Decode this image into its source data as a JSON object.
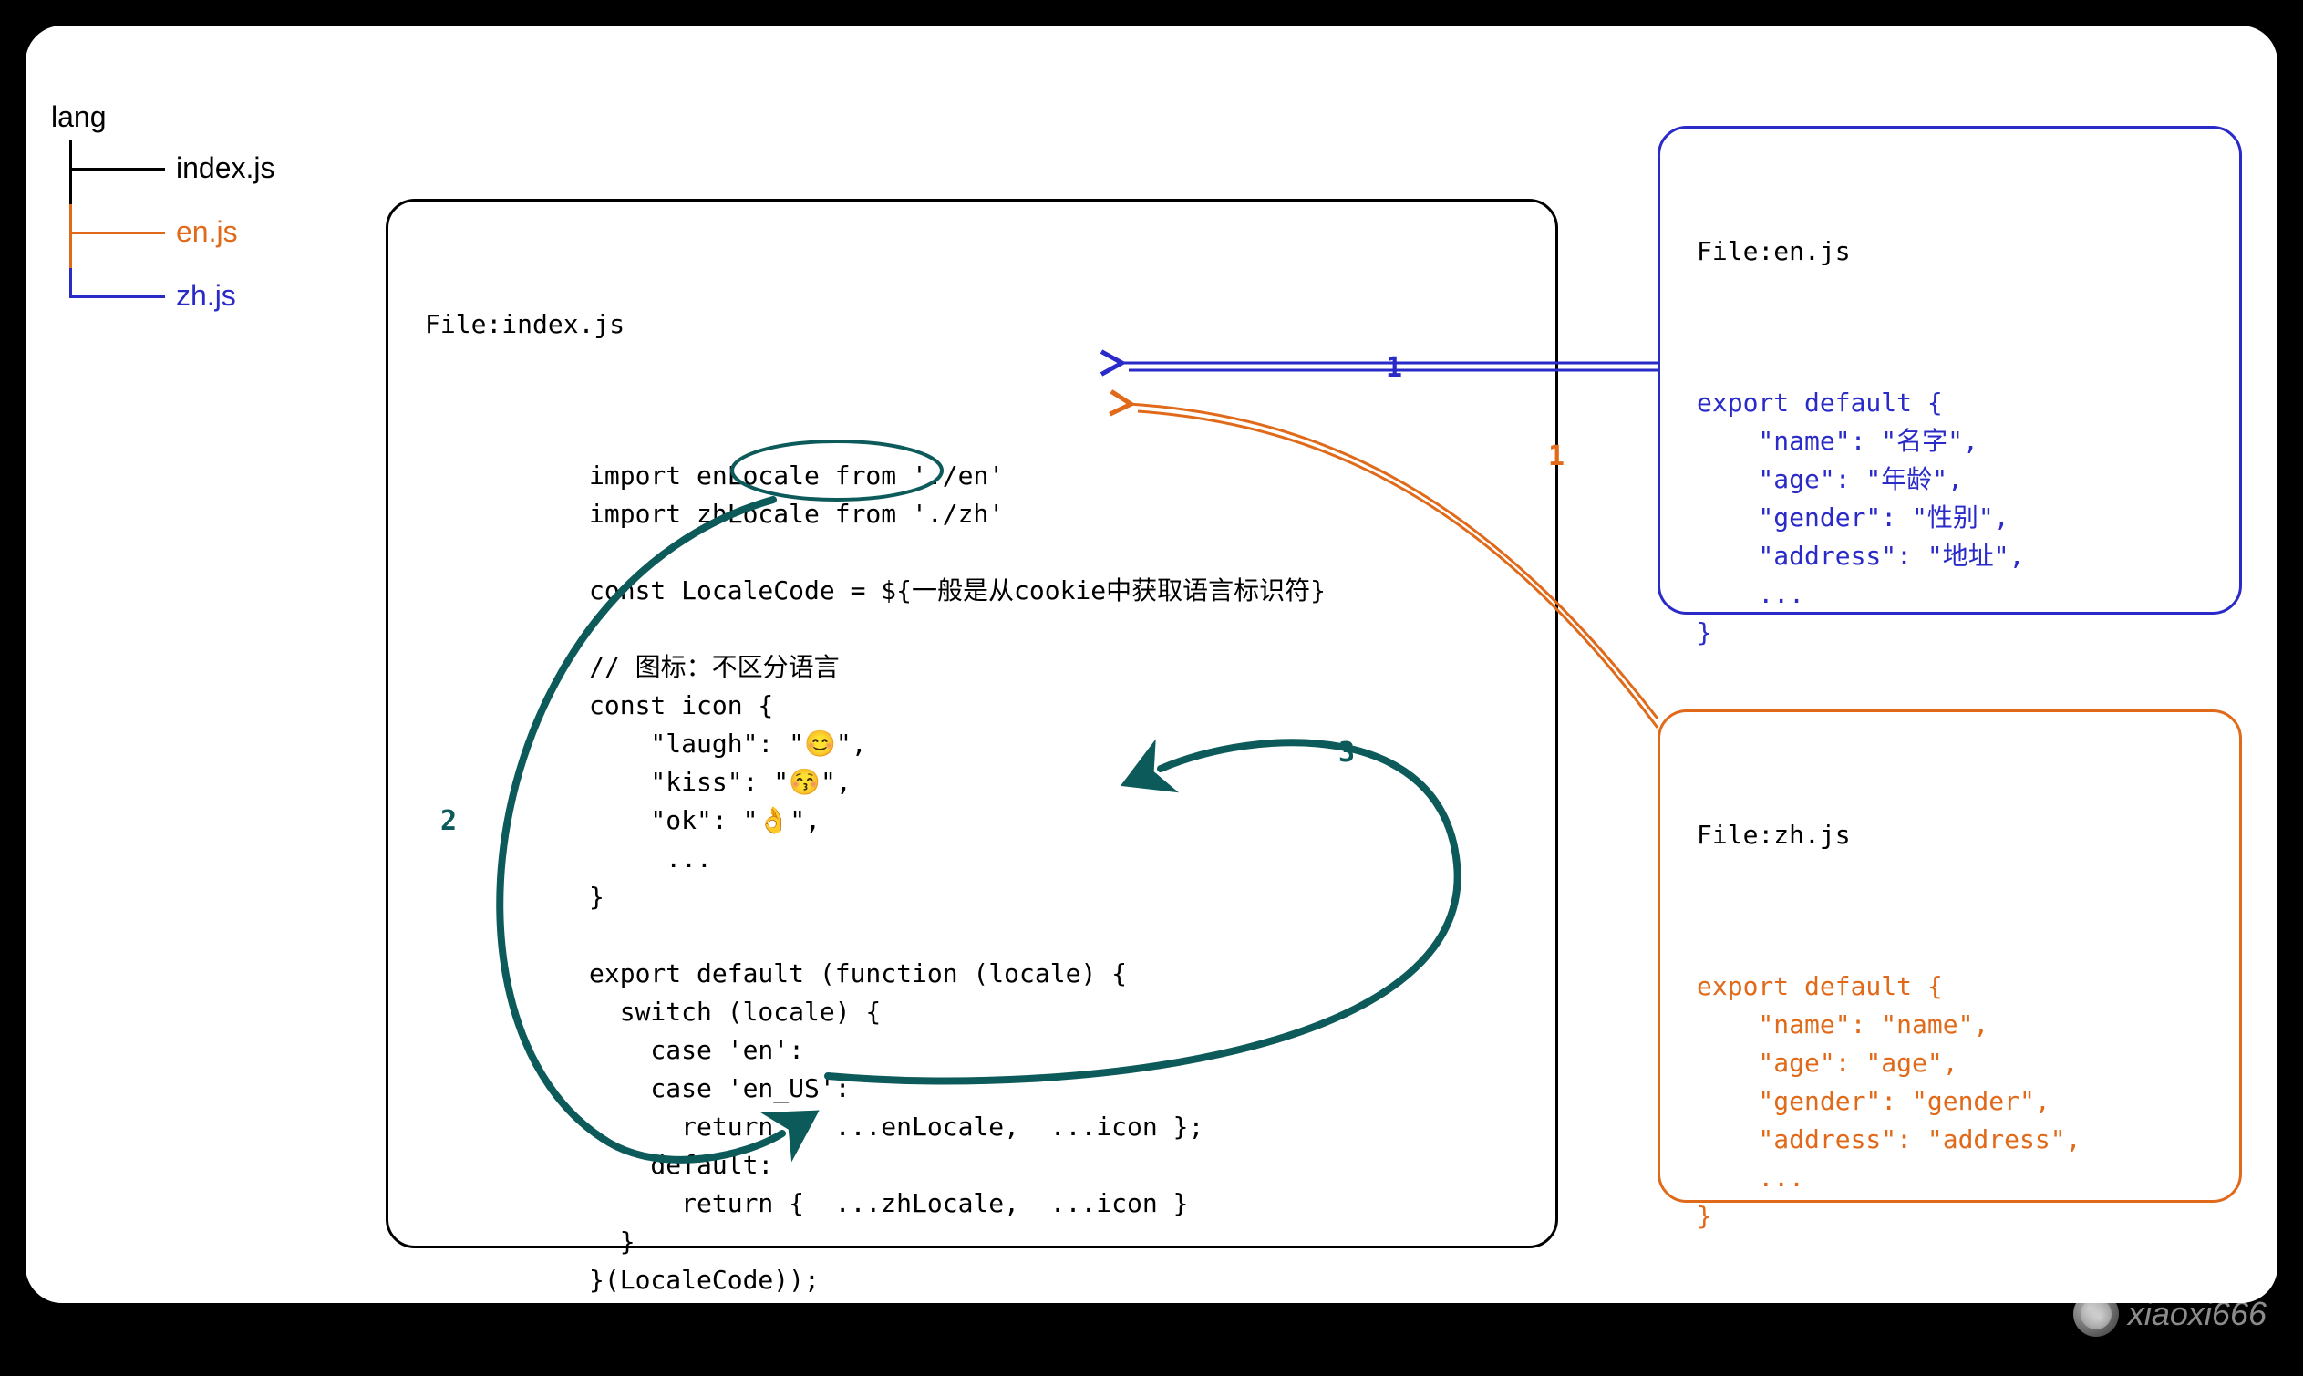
{
  "tree": {
    "root": "lang",
    "items": [
      {
        "label": "index.js",
        "color": "#000000"
      },
      {
        "label": "en.js",
        "color": "#e06a1a"
      },
      {
        "label": "zh.js",
        "color": "#2a2ac8"
      }
    ]
  },
  "annotations": {
    "arrow_en_label": "1",
    "arrow_zh_label": "1",
    "flow_down_label": "2",
    "flow_return_label": "3"
  },
  "colors": {
    "en_arrow": "#2a2ac8",
    "zh_arrow": "#e06a1a",
    "flow_arrow": "#0d5a5a"
  },
  "watermark": "xiaoxi666",
  "files": {
    "index": {
      "title": "File:index.js",
      "code": "import enLocale from './en'\nimport zhLocale from './zh'\n\nconst LocaleCode = ${一般是从cookie中获取语言标识符}\n\n// 图标：不区分语言\nconst icon {\n    \"laugh\": \"😊\",\n    \"kiss\": \"😚\",\n    \"ok\": \"👌\",\n     ...\n}\n\nexport default (function (locale) {\n  switch (locale) {\n    case 'en':\n    case 'en_US':\n      return {  ...enLocale,  ...icon };\n    default:\n      return {  ...zhLocale,  ...icon }\n  }\n}(LocaleCode));"
    },
    "en": {
      "title": "File:en.js",
      "code": "export default {\n    \"name\": \"名字\",\n    \"age\": \"年龄\",\n    \"gender\": \"性别\",\n    \"address\": \"地址\",\n    ...\n}"
    },
    "zh": {
      "title": "File:zh.js",
      "code": "export default {\n    \"name\": \"name\",\n    \"age\": \"age\",\n    \"gender\": \"gender\",\n    \"address\": \"address\",\n    ...\n}"
    }
  }
}
